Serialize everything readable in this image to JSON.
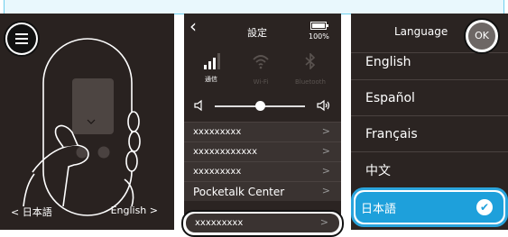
{
  "screen1": {
    "prev_language": "< 日本語",
    "next_language": "English >"
  },
  "settings": {
    "title": "設定",
    "battery": "100%",
    "connectivity": [
      {
        "label": "通信"
      },
      {
        "label": "Wi-Fi"
      },
      {
        "label": "Bluetooth"
      }
    ],
    "volume_level": 0.5,
    "menu": [
      {
        "label": "xxxxxxxxx"
      },
      {
        "label": "xxxxxxxxxxxx"
      },
      {
        "label": "xxxxxxxxx"
      },
      {
        "label": "Pocketalk Center"
      },
      {
        "label": "xxxxxxxxx"
      }
    ],
    "chevron": ">"
  },
  "language": {
    "title": "Language",
    "ok_label": "OK",
    "options": [
      {
        "label": "English"
      },
      {
        "label": "Español"
      },
      {
        "label": "Français"
      },
      {
        "label": "中文"
      }
    ],
    "selected": "日本語"
  },
  "colors": {
    "panel_bg": "#2b2422",
    "accent": "#1ea0db",
    "banner_border": "#6fd0ee"
  }
}
